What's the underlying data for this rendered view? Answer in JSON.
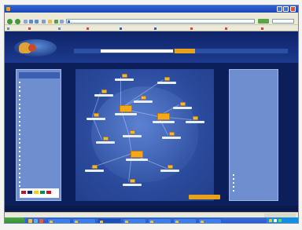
{
  "window": {
    "title": "",
    "menu": [
      "",
      "",
      "",
      "",
      "",
      ""
    ]
  },
  "toolbar": {
    "address": "",
    "go_label": ""
  },
  "links": [
    "",
    "",
    "",
    "",
    "",
    "",
    "",
    "",
    ""
  ],
  "site": {
    "nav": [
      "",
      "",
      "",
      ""
    ],
    "side_title": "",
    "side_items": [
      "",
      "",
      "",
      "",
      "",
      "",
      "",
      "",
      "",
      "",
      "",
      "",
      "",
      "",
      "",
      "",
      "",
      "",
      "",
      "",
      "",
      "",
      "",
      "",
      ""
    ],
    "right_items": [
      "",
      "",
      "",
      "",
      ""
    ],
    "legend_label": "",
    "footer": "",
    "map_nodes": [
      "",
      "",
      "",
      "",
      "",
      "",
      "",
      "",
      "",
      "",
      "",
      "",
      "",
      "",
      "",
      ""
    ]
  },
  "status": {
    "text": ""
  },
  "taskbar": {
    "start_label": "",
    "tasks": [
      "",
      "",
      "",
      "",
      "",
      "",
      ""
    ],
    "clock": ""
  },
  "colors": {
    "page_bg": "#0c1f5a",
    "panel": "#6e8ecf",
    "map": "#2a4a9c",
    "accent": "#f0b73a",
    "taskbar": "#2357c8"
  }
}
